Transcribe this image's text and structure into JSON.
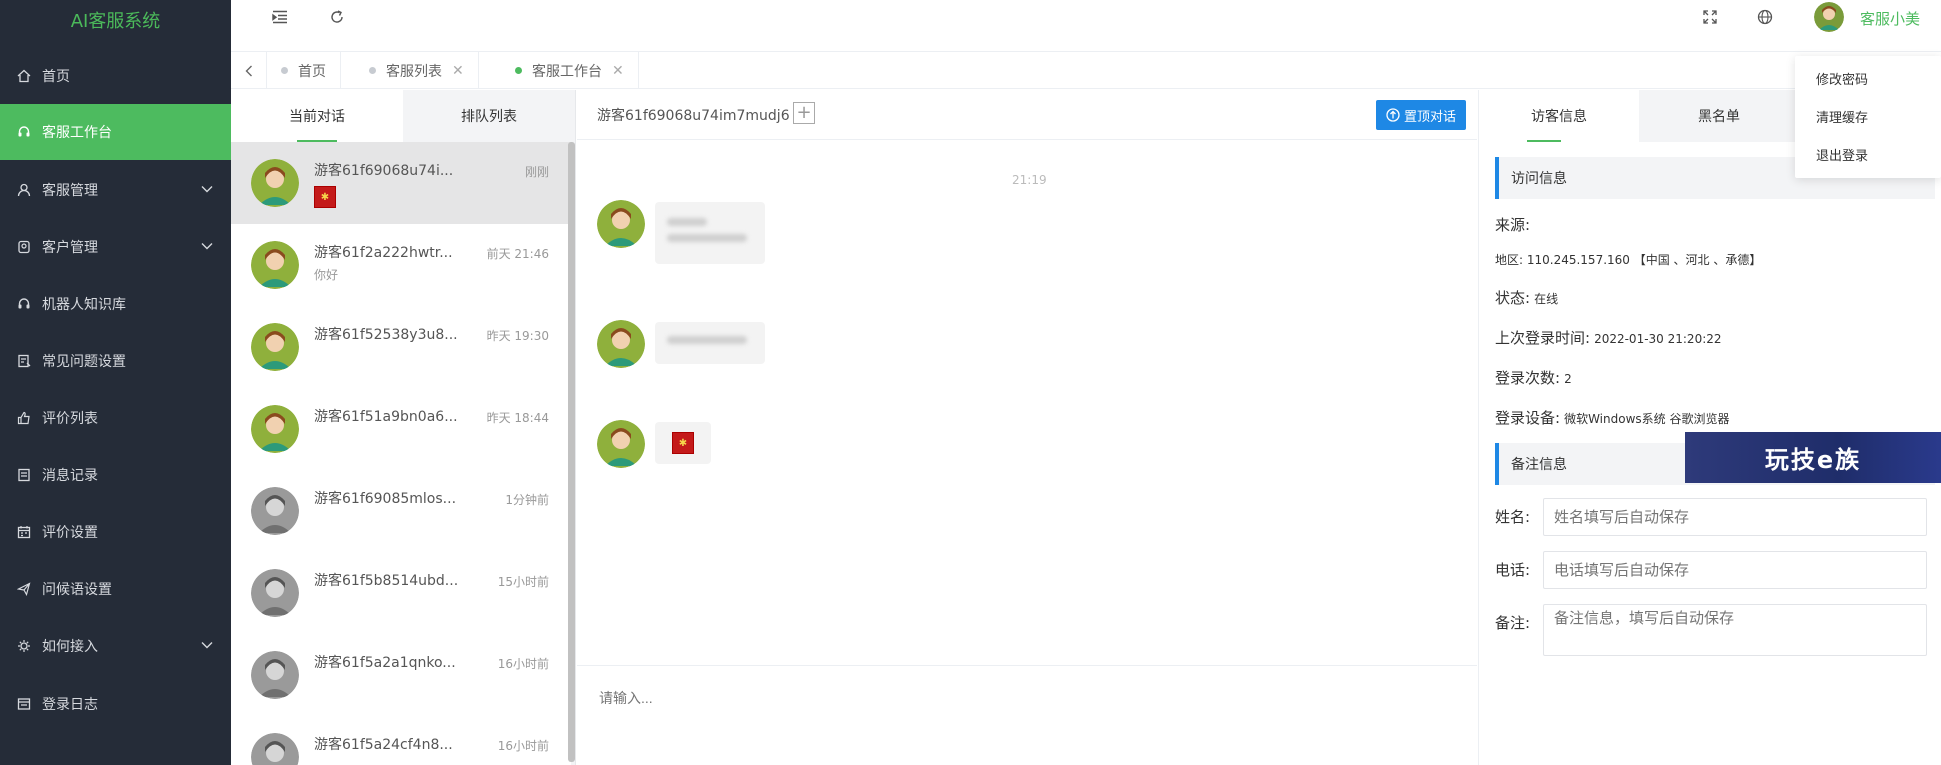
{
  "app": {
    "title": "AI客服系统"
  },
  "sidebar": {
    "items": [
      {
        "label": "首页",
        "icon": "home-icon"
      },
      {
        "label": "客服工作台",
        "icon": "headset-icon",
        "active": true
      },
      {
        "label": "客服管理",
        "icon": "user-icon",
        "expandable": true
      },
      {
        "label": "客户管理",
        "icon": "customer-icon",
        "expandable": true
      },
      {
        "label": "机器人知识库",
        "icon": "robot-icon"
      },
      {
        "label": "常见问题设置",
        "icon": "faq-icon"
      },
      {
        "label": "评价列表",
        "icon": "thumbs-up-icon"
      },
      {
        "label": "消息记录",
        "icon": "message-icon"
      },
      {
        "label": "评价设置",
        "icon": "calendar-icon"
      },
      {
        "label": "问候语设置",
        "icon": "send-icon"
      },
      {
        "label": "如何接入",
        "icon": "plug-icon",
        "expandable": true
      },
      {
        "label": "登录日志",
        "icon": "log-icon"
      }
    ]
  },
  "header": {
    "user_name": "客服小美"
  },
  "tabs": [
    {
      "label": "首页"
    },
    {
      "label": "客服列表"
    },
    {
      "label": "客服工作台",
      "active": true
    }
  ],
  "conversations": {
    "tabs": [
      "当前对话",
      "排队列表"
    ],
    "items": [
      {
        "name": "游客61f69068u74i...",
        "time": "刚刚",
        "msg": "",
        "online": true
      },
      {
        "name": "游客61f2a222hwtr...",
        "time": "前天 21:46",
        "msg": "你好",
        "online": true
      },
      {
        "name": "游客61f52538y3u8...",
        "time": "昨天 19:30",
        "msg": "",
        "online": true
      },
      {
        "name": "游客61f51a9bn0a6...",
        "time": "昨天 18:44",
        "msg": "",
        "online": true
      },
      {
        "name": "游客61f69085mlos...",
        "time": "1分钟前",
        "msg": "",
        "online": false
      },
      {
        "name": "游客61f5b8514ubd...",
        "time": "15小时前",
        "msg": "",
        "online": false
      },
      {
        "name": "游客61f5a2a1qnko...",
        "time": "16小时前",
        "msg": "",
        "online": false
      },
      {
        "name": "游客61f5a24cf4n8...",
        "time": "16小时前",
        "msg": "",
        "online": false
      }
    ]
  },
  "chat": {
    "title": "游客61f69068u74im7mudj6",
    "top_button": "置顶对话",
    "time": "21:19",
    "input_placeholder": "请输入..."
  },
  "visitor": {
    "tabs": [
      "访客信息",
      "黑名单"
    ],
    "section_title": "访问信息",
    "source_label": "来源:",
    "region": "地区: 110.245.157.160 【中国 、河北 、承德】",
    "status_label": "状态:",
    "status_value": "在线",
    "last_login_label": "上次登录时间:",
    "last_login_value": "2022-01-30 21:20:22",
    "login_count_label": "登录次数:",
    "login_count_value": "2",
    "device_label": "登录设备:",
    "device_value": "微软Windows系统 谷歌浏览器",
    "notes_title": "备注信息",
    "name_label": "姓名:",
    "name_placeholder": "姓名填写后自动保存",
    "phone_label": "电话:",
    "phone_placeholder": "电话填写后自动保存",
    "remark_label": "备注:",
    "remark_placeholder": "备注信息，填写后自动保存"
  },
  "dropdown": {
    "items": [
      "修改密码",
      "清理缓存",
      "退出登录"
    ]
  },
  "banner": {
    "text": "玩技e族"
  },
  "colors": {
    "accent": "#4dbb5f",
    "sidebar_bg": "#252c38",
    "primary_btn": "#1e88e5"
  }
}
